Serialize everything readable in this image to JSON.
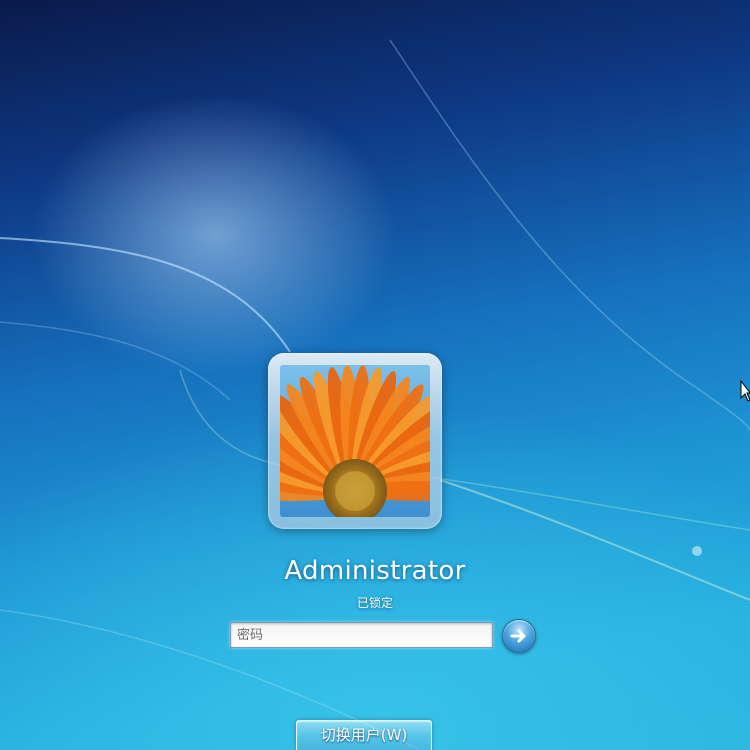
{
  "login": {
    "user_name": "Administrator",
    "status": "已锁定",
    "password_placeholder": "密码",
    "password_value": "",
    "submit_icon": "arrow-right-icon",
    "switch_user_label": "切换用户(W)"
  },
  "avatar": {
    "image": "orange-gerbera-flower"
  },
  "colors": {
    "background_top": "#0a1a4a",
    "background_mid": "#1670bd",
    "background_bottom": "#2bb3df",
    "petal": "#f07a1e",
    "accent_button": "#4aa4de"
  }
}
